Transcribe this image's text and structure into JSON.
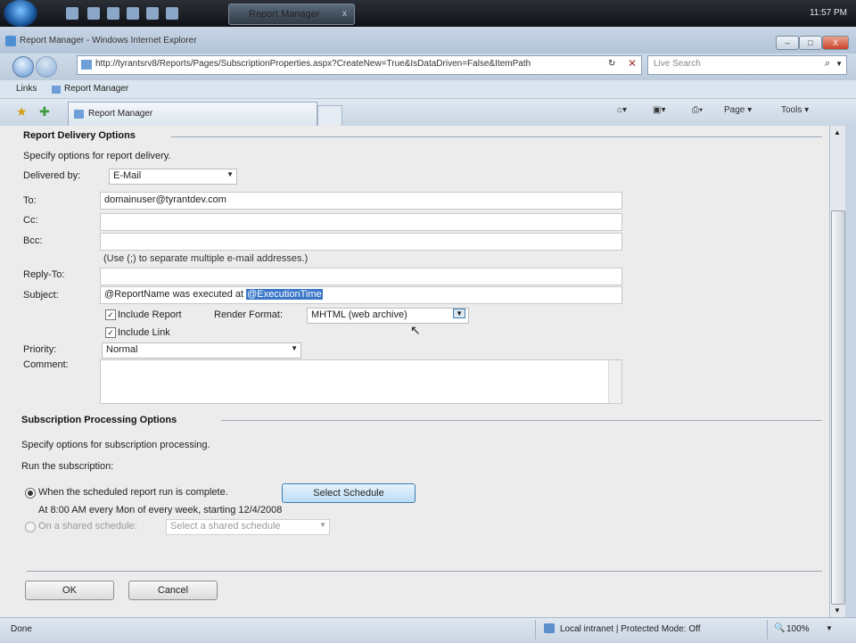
{
  "taskbar": {
    "task_label": "Report Manager",
    "task_close": "x",
    "clock": "11:57 PM"
  },
  "window": {
    "title": "Report Manager - Windows Internet Explorer",
    "min": "–",
    "max": "□",
    "close": "X"
  },
  "address": {
    "url": "http://tyrantsrv8/Reports/Pages/SubscriptionProperties.aspx?CreateNew=True&IsDataDriven=False&ItemPath",
    "search_placeholder": "Live Search"
  },
  "links": {
    "label": "Links",
    "item": "Report Manager"
  },
  "tab": {
    "label": "Report Manager"
  },
  "commands": {
    "page": "Page",
    "tools": "Tools"
  },
  "delivery": {
    "section_title": "Report Delivery Options",
    "instructions": "Specify options for report delivery.",
    "delivered_by_label": "Delivered by:",
    "delivered_by_value": "E-Mail",
    "to_label": "To:",
    "to_value": "domainuser@tyrantdev.com",
    "cc_label": "Cc:",
    "cc_value": "",
    "bcc_label": "Bcc:",
    "bcc_hint": "(Use (;) to separate multiple e-mail addresses.)",
    "reply_to_label": "Reply-To:",
    "reply_to_value": "",
    "subject_label": "Subject:",
    "subject_prefix": "@ReportName was executed at ",
    "subject_selected": "@ExecutionTime",
    "include_report_label": "Include Report",
    "render_format_label": "Render Format:",
    "render_format_value": "MHTML (web archive)",
    "include_link_label": "Include Link",
    "priority_label": "Priority:",
    "priority_value": "Normal",
    "comment_label": "Comment:",
    "comment_value": ""
  },
  "processing": {
    "section_title": "Subscription Processing Options",
    "instructions": "Specify options for subscription processing.",
    "run_label": "Run the subscription:",
    "option_scheduled": "When the scheduled report run is complete.",
    "select_schedule_button": "Select Schedule",
    "schedule_description": "At 8:00 AM every Mon of every week, starting 12/4/2008",
    "option_shared": "On a shared schedule:",
    "shared_placeholder": "Select a shared schedule"
  },
  "actions": {
    "ok": "OK",
    "cancel": "Cancel"
  },
  "status": {
    "left": "Done",
    "zone": "Local intranet | Protected Mode: Off",
    "zoom": "100%"
  }
}
